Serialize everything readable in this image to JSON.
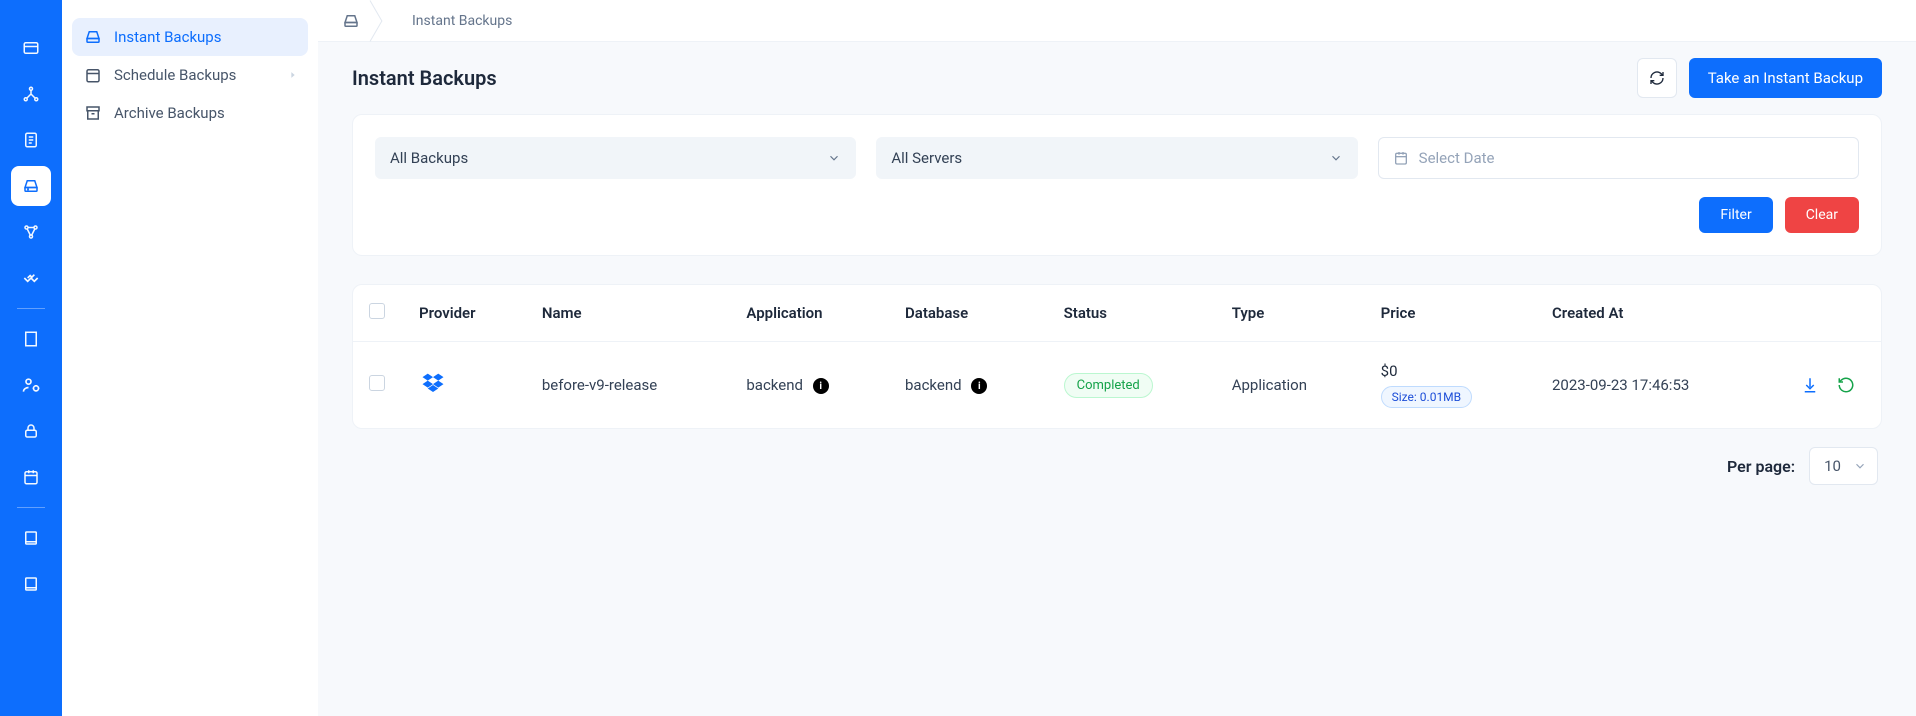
{
  "breadcrumb": {
    "current": "Instant Backups"
  },
  "sidebar": {
    "items": [
      {
        "label": "Instant Backups"
      },
      {
        "label": "Schedule Backups"
      },
      {
        "label": "Archive Backups"
      }
    ]
  },
  "page": {
    "title": "Instant Backups",
    "take_backup_label": "Take an Instant Backup"
  },
  "filters": {
    "backups_select": "All Backups",
    "servers_select": "All Servers",
    "date_placeholder": "Select Date",
    "filter_label": "Filter",
    "clear_label": "Clear"
  },
  "table": {
    "headers": {
      "provider": "Provider",
      "name": "Name",
      "application": "Application",
      "database": "Database",
      "status": "Status",
      "type": "Type",
      "price": "Price",
      "created_at": "Created At"
    },
    "rows": [
      {
        "provider": "dropbox",
        "name": "before-v9-release",
        "application": "backend",
        "database": "backend",
        "status": "Completed",
        "type": "Application",
        "price": "$0",
        "size": "Size: 0.01MB",
        "created_at": "2023-09-23 17:46:53"
      }
    ]
  },
  "pagination": {
    "label": "Per page:",
    "value": "10"
  }
}
